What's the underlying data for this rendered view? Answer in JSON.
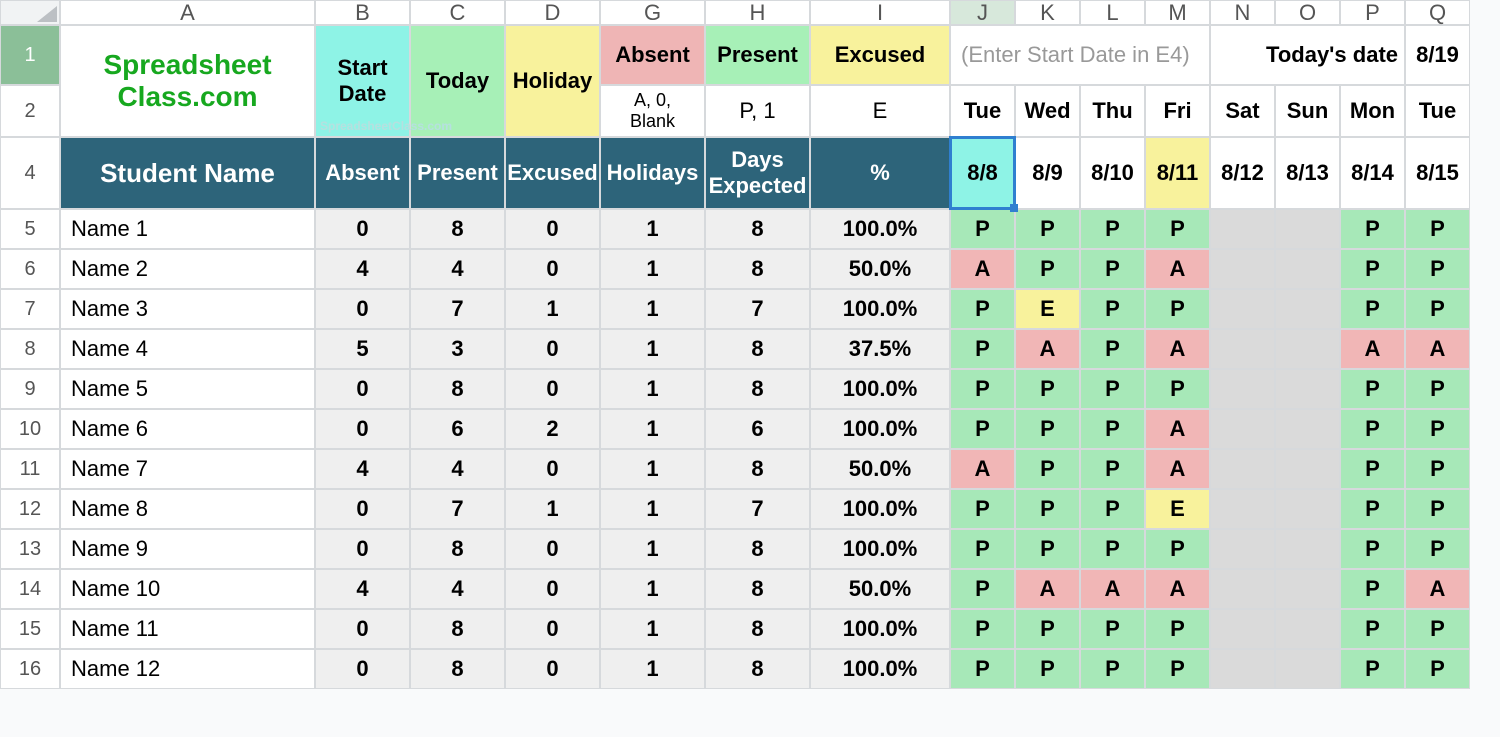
{
  "logo": "Spreadsheet Class.com",
  "watermark": "SpreadsheetClass.com",
  "columns": [
    "A",
    "B",
    "C",
    "D",
    "G",
    "H",
    "I",
    "J",
    "K",
    "L",
    "M",
    "N",
    "O",
    "P",
    "Q"
  ],
  "legend": {
    "start_date": "Start Date",
    "today": "Today",
    "holiday": "Holiday",
    "absent": "Absent",
    "present": "Present",
    "excused": "Excused",
    "absent_codes": "A, 0, Blank",
    "present_codes": "P, 1",
    "excused_codes": "E"
  },
  "enter_hint": "(Enter Start Date in E4)",
  "todays_date_label": "Today's date",
  "todays_date": "8/19",
  "days_of_week": [
    "Tue",
    "Wed",
    "Thu",
    "Fri",
    "Sat",
    "Sun",
    "Mon",
    "Tue"
  ],
  "header4": {
    "student": "Student Name",
    "absent": "Absent",
    "present": "Present",
    "excused": "Excused",
    "holidays": "Holidays",
    "days_expected": "Days Expected",
    "pct": "%"
  },
  "date_cols": [
    "8/8",
    "8/9",
    "8/10",
    "8/11",
    "8/12",
    "8/13",
    "8/14",
    "8/15"
  ],
  "holiday_idx": 3,
  "weekend_idx": [
    4,
    5
  ],
  "active_col_idx": 0,
  "rows": [
    {
      "n": 5,
      "name": "Name 1",
      "a": 0,
      "p": 8,
      "e": 0,
      "h": 1,
      "de": 8,
      "pct": "100.0%",
      "d": [
        "P",
        "P",
        "P",
        "P",
        "",
        "",
        "P",
        "P"
      ]
    },
    {
      "n": 6,
      "name": "Name 2",
      "a": 4,
      "p": 4,
      "e": 0,
      "h": 1,
      "de": 8,
      "pct": "50.0%",
      "d": [
        "A",
        "P",
        "P",
        "A",
        "",
        "",
        "P",
        "P"
      ]
    },
    {
      "n": 7,
      "name": "Name 3",
      "a": 0,
      "p": 7,
      "e": 1,
      "h": 1,
      "de": 7,
      "pct": "100.0%",
      "d": [
        "P",
        "E",
        "P",
        "P",
        "",
        "",
        "P",
        "P"
      ]
    },
    {
      "n": 8,
      "name": "Name 4",
      "a": 5,
      "p": 3,
      "e": 0,
      "h": 1,
      "de": 8,
      "pct": "37.5%",
      "d": [
        "P",
        "A",
        "P",
        "A",
        "",
        "",
        "A",
        "A"
      ]
    },
    {
      "n": 9,
      "name": "Name 5",
      "a": 0,
      "p": 8,
      "e": 0,
      "h": 1,
      "de": 8,
      "pct": "100.0%",
      "d": [
        "P",
        "P",
        "P",
        "P",
        "",
        "",
        "P",
        "P"
      ]
    },
    {
      "n": 10,
      "name": "Name 6",
      "a": 0,
      "p": 6,
      "e": 2,
      "h": 1,
      "de": 6,
      "pct": "100.0%",
      "d": [
        "P",
        "P",
        "P",
        "A",
        "",
        "",
        "P",
        "P"
      ]
    },
    {
      "n": 11,
      "name": "Name 7",
      "a": 4,
      "p": 4,
      "e": 0,
      "h": 1,
      "de": 8,
      "pct": "50.0%",
      "d": [
        "A",
        "P",
        "P",
        "A",
        "",
        "",
        "P",
        "P"
      ]
    },
    {
      "n": 12,
      "name": "Name 8",
      "a": 0,
      "p": 7,
      "e": 1,
      "h": 1,
      "de": 7,
      "pct": "100.0%",
      "d": [
        "P",
        "P",
        "P",
        "E",
        "",
        "",
        "P",
        "P"
      ]
    },
    {
      "n": 13,
      "name": "Name 9",
      "a": 0,
      "p": 8,
      "e": 0,
      "h": 1,
      "de": 8,
      "pct": "100.0%",
      "d": [
        "P",
        "P",
        "P",
        "P",
        "",
        "",
        "P",
        "P"
      ]
    },
    {
      "n": 14,
      "name": "Name 10",
      "a": 4,
      "p": 4,
      "e": 0,
      "h": 1,
      "de": 8,
      "pct": "50.0%",
      "d": [
        "P",
        "A",
        "A",
        "A",
        "",
        "",
        "P",
        "A"
      ]
    },
    {
      "n": 15,
      "name": "Name 11",
      "a": 0,
      "p": 8,
      "e": 0,
      "h": 1,
      "de": 8,
      "pct": "100.0%",
      "d": [
        "P",
        "P",
        "P",
        "P",
        "",
        "",
        "P",
        "P"
      ]
    },
    {
      "n": 16,
      "name": "Name 12",
      "a": 0,
      "p": 8,
      "e": 0,
      "h": 1,
      "de": 8,
      "pct": "100.0%",
      "d": [
        "P",
        "P",
        "P",
        "P",
        "",
        "",
        "P",
        "P"
      ]
    }
  ],
  "colors": {
    "teal_header": "#2d647a",
    "cyan": "#8ef3e6",
    "green": "#a7f0b7",
    "yellow": "#f8f29c",
    "pink": "#efb5b5"
  }
}
